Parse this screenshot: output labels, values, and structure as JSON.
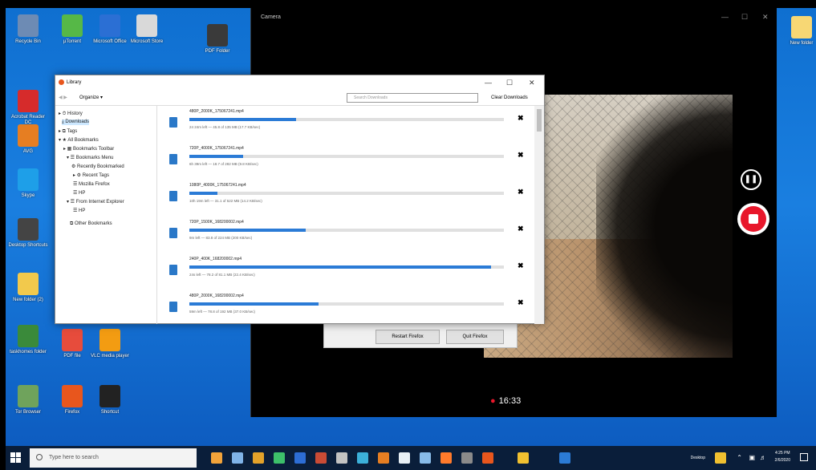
{
  "desktop": {
    "icons": [
      {
        "id": "recycle-bin",
        "label": "Recycle Bin",
        "color": "#6d8bb4"
      },
      {
        "id": "utorrent",
        "label": "µTorrent",
        "color": "#56b847"
      },
      {
        "id": "microsoft-office",
        "label": "Microsoft Office",
        "color": "#2b6fd4"
      },
      {
        "id": "document",
        "label": "Microsoft Store",
        "color": "#d9d9d9"
      },
      {
        "id": "pdf-folder",
        "label": "PDF Folder",
        "color": "#3a3a3a"
      },
      {
        "id": "acrobat",
        "label": "Acrobat Reader DC",
        "color": "#d62b2b"
      },
      {
        "id": "avg",
        "label": "AVG",
        "color": "#e67e22"
      },
      {
        "id": "skype",
        "label": "Skype",
        "color": "#1e9fe8"
      },
      {
        "id": "desktop-shortcuts",
        "label": "Desktop Shortcuts",
        "color": "#444"
      },
      {
        "id": "new-folder-25",
        "label": "New folder (2)",
        "color": "#f2c94c"
      },
      {
        "id": "taskhomes",
        "label": "taskhomes folder",
        "color": "#3a8a3a"
      },
      {
        "id": "tor-browser",
        "label": "Tor Browser",
        "color": "#6fa35c"
      },
      {
        "id": "pdf-file",
        "label": "PDF file",
        "color": "#e74c3c"
      },
      {
        "id": "vlc",
        "label": "VLC media player",
        "color": "#f39c12"
      },
      {
        "id": "firefox",
        "label": "Firefox",
        "color": "#e8561d"
      },
      {
        "id": "shortcut",
        "label": "Shortcut",
        "color": "#222"
      },
      {
        "id": "new-folder",
        "label": "New folder",
        "color": "#f7d774"
      }
    ]
  },
  "camera": {
    "title": "Camera",
    "minimize": "—",
    "maximize": "☐",
    "close": "✕",
    "pause_icon": "❚❚",
    "timer_dot": "●",
    "timer": "16:33"
  },
  "restart_dialog": {
    "restart_label": "Restart Firefox",
    "quit_label": "Quit Firefox"
  },
  "library": {
    "title": "Library",
    "organize_label": "Organize ▾",
    "search_placeholder": "Search Downloads",
    "clear_label": "Clear Downloads",
    "minimize": "—",
    "maximize": "☐",
    "close": "✕",
    "tree": [
      {
        "label": "▸ ⏱ History",
        "selected": false
      },
      {
        "label": "⤓ Downloads",
        "selected": true
      },
      {
        "label": "▸ ⧉ Tags",
        "selected": false
      },
      {
        "label": "▾ ★ All Bookmarks",
        "selected": false
      },
      {
        "label": "▸ ▦ Bookmarks Toolbar",
        "selected": false
      },
      {
        "label": "▾ ☰ Bookmarks Menu",
        "selected": false
      },
      {
        "label": "⚙ Recently Bookmarked",
        "selected": false
      },
      {
        "label": "▸ ⚙ Recent Tags",
        "selected": false
      },
      {
        "label": "☰ Mozilla Firefox",
        "selected": false
      },
      {
        "label": "☰ HP",
        "selected": false
      },
      {
        "label": "▾ ☰ From Internet Explorer",
        "selected": false
      },
      {
        "label": "☰ HP",
        "selected": false
      },
      {
        "label": "⧉ Other Bookmarks",
        "selected": false
      }
    ],
    "downloads": [
      {
        "name": "480P_2000K_175067241.mp4",
        "status": "24 24m left — 45.8 of 135 MB (17.7 KB/sec)",
        "progress": 0.34
      },
      {
        "name": "720P_4000K_175067241.mp4",
        "status": "6h 39m left — 18.7 of 282 MB (9.8 KB/sec)",
        "progress": 0.17
      },
      {
        "name": "1080P_4000K_175067241.mp4",
        "status": "10h 19m left — 31.1 of 522 MB (14.2 KB/sec)",
        "progress": 0.09
      },
      {
        "name": "720P_1500K_168200002.mp4",
        "status": "9m left — 83.8 of 224 MB (200 KB/sec)",
        "progress": 0.37
      },
      {
        "name": "240P_400K_168200002.mp4",
        "status": "24s left — 78.2 of 81.1 MB (22.4 KB/sec)",
        "progress": 0.96
      },
      {
        "name": "480P_2000K_168200002.mp4",
        "status": "59m left — 78.8 of 192 MB (37.0 KB/sec)",
        "progress": 0.41
      }
    ],
    "remove_icon": "✖"
  },
  "taskbar": {
    "search_placeholder": "Type here to search",
    "desktop_label": "Desktop",
    "time": "4:25 PM",
    "date": "2/6/2020",
    "apps": [
      "#f2a33a",
      "#7fb3e8",
      "#e3a22a",
      "#3dc06a",
      "#2d6dd4",
      "#c94b35",
      "#c2c2c2",
      "#3cb0d9",
      "#e67e22",
      "#e8f0f5",
      "#88bbe8",
      "#ff7a2b",
      "#8a8a8a",
      "#e8561d",
      "#f0c030",
      "#2b7bd6"
    ]
  }
}
